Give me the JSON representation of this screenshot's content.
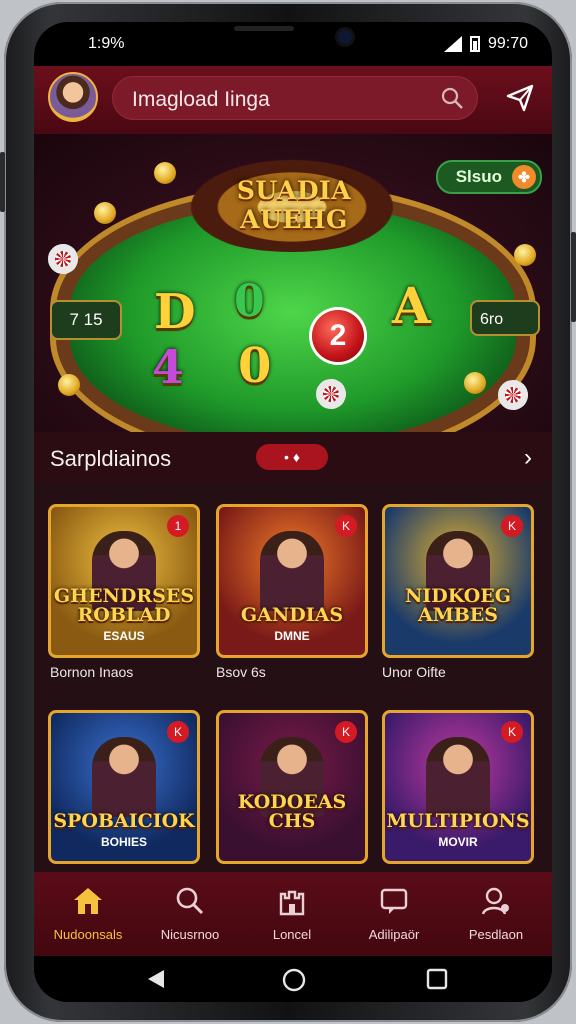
{
  "status": {
    "time_left": "1:9%",
    "time_right": "99:70"
  },
  "header": {
    "search_text": "Imagload Iinga"
  },
  "hero": {
    "title": "SUADIA AUEHG",
    "badge": "Slsuo",
    "chip_left": "7 15",
    "chip_right": "6ro",
    "symbols": [
      "D",
      "4",
      "0",
      "0",
      "A"
    ],
    "ball": "2"
  },
  "section": {
    "title": "Sarpldiainos",
    "pill": "•  ♦",
    "arrow": "›"
  },
  "games": [
    {
      "title": "GHENDRSES ROBLAD",
      "subtitle": "ESAUS",
      "badge": "1",
      "label": "Bornon Inaos",
      "bg": "#8a5a12",
      "glow": "#f0c040"
    },
    {
      "title": "GANDIAS",
      "subtitle": "DMNE",
      "badge": "K",
      "label": "Bsov 6s",
      "bg": "#7a1a18",
      "glow": "#f07a28"
    },
    {
      "title": "NIDKOEG AMBES",
      "subtitle": "",
      "badge": "K",
      "label": "Unor Oifte",
      "bg": "#1a3a6a",
      "glow": "#e0b030"
    },
    {
      "title": "SPOBAICIOK",
      "subtitle": "BOHIES",
      "badge": "K",
      "label": "",
      "bg": "#102a60",
      "glow": "#3a70d0"
    },
    {
      "title": "KODOEAS CHS",
      "subtitle": "",
      "badge": "K",
      "label": "",
      "bg": "#3a1030",
      "glow": "#7a1a4a"
    },
    {
      "title": "MULTIPIONS",
      "subtitle": "MOVIR",
      "badge": "K",
      "label": "",
      "bg": "#3a1a6a",
      "glow": "#c03aa0"
    }
  ],
  "nav": [
    {
      "label": "Nudoonsals",
      "icon": "home-icon",
      "active": true
    },
    {
      "label": "Nicusrnoo",
      "icon": "search-icon",
      "active": false
    },
    {
      "label": "Loncel",
      "icon": "castle-icon",
      "active": false
    },
    {
      "label": "Adilipaör",
      "icon": "chat-icon",
      "active": false
    },
    {
      "label": "Pesdlaon",
      "icon": "profile-icon",
      "active": false
    }
  ],
  "colors": {
    "accent": "#f6c23e",
    "topbar": "#6c0f1c",
    "table_green": "#1f9a2a"
  }
}
